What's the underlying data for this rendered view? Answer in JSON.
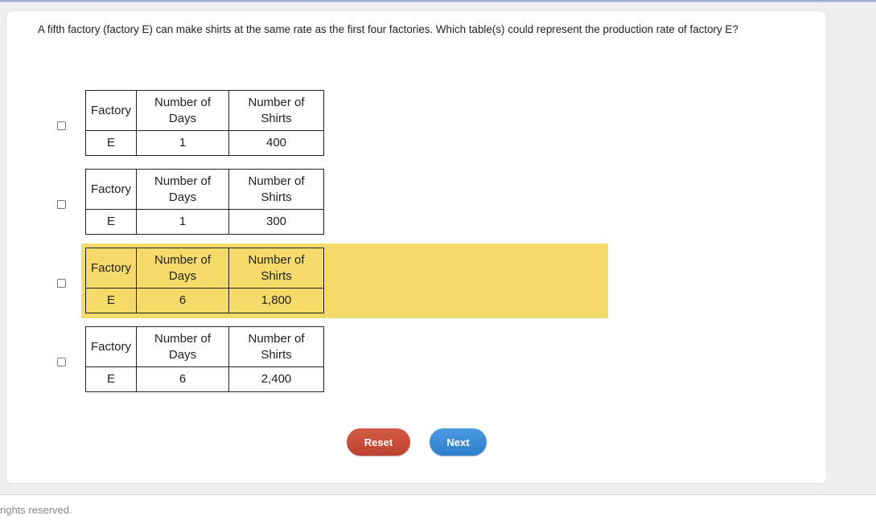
{
  "question": "A fifth factory (factory E) can make shirts at the same rate as the first four factories. Which table(s) could represent the production rate of factory E?",
  "table_headers": {
    "factory": "Factory",
    "days": "Number of Days",
    "shirts": "Number of Shirts"
  },
  "options": [
    {
      "factory": "E",
      "days": "1",
      "shirts": "400",
      "checked": false,
      "highlighted": false
    },
    {
      "factory": "E",
      "days": "1",
      "shirts": "300",
      "checked": false,
      "highlighted": false
    },
    {
      "factory": "E",
      "days": "6",
      "shirts": "1,800",
      "checked": false,
      "highlighted": true
    },
    {
      "factory": "E",
      "days": "6",
      "shirts": "2,400",
      "checked": false,
      "highlighted": false
    }
  ],
  "buttons": {
    "reset": "Reset",
    "next": "Next"
  },
  "colors": {
    "highlight": "#f5db6a",
    "reset": "#c94a35",
    "next": "#3a8bd6"
  },
  "footer": "rights reserved."
}
